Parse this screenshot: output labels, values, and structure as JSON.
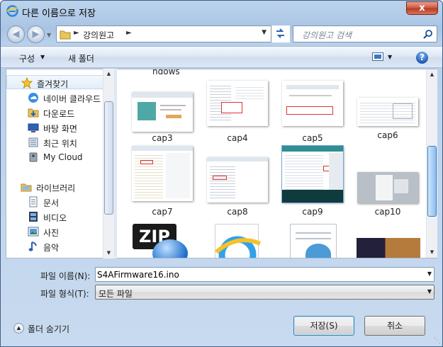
{
  "window": {
    "title": "다른 이름으로 저장",
    "close_label": "x"
  },
  "address": {
    "crumb": "강의원고"
  },
  "search": {
    "placeholder": "강의원고 검색"
  },
  "toolbar": {
    "organize_label": "구성",
    "new_folder_label": "새 폴더",
    "help_label": "?"
  },
  "nav": {
    "favorites_label": "즐겨찾기",
    "favorites": [
      "네이버 클라우드",
      "다운로드",
      "바탕 화면",
      "최근 위치",
      "My Cloud"
    ],
    "library_label": "라이브러리",
    "libraries": [
      "문서",
      "비디오",
      "사진",
      "음악"
    ]
  },
  "files": {
    "cut_label": "ndows",
    "row1": [
      "cap3",
      "cap4",
      "cap5",
      "cap6"
    ],
    "row2": [
      "cap7",
      "cap8",
      "cap9",
      "cap10"
    ],
    "zip_text": "ZIP"
  },
  "form": {
    "filename_label": "파일 이름(N):",
    "filename_value": "S4AFirmware16.ino",
    "filetype_label": "파일 형식(T):",
    "filetype_value": "모든 파일"
  },
  "footer": {
    "hide_folders_label": "폴더 숨기기",
    "save_label": "저장(S)",
    "cancel_label": "취소"
  }
}
